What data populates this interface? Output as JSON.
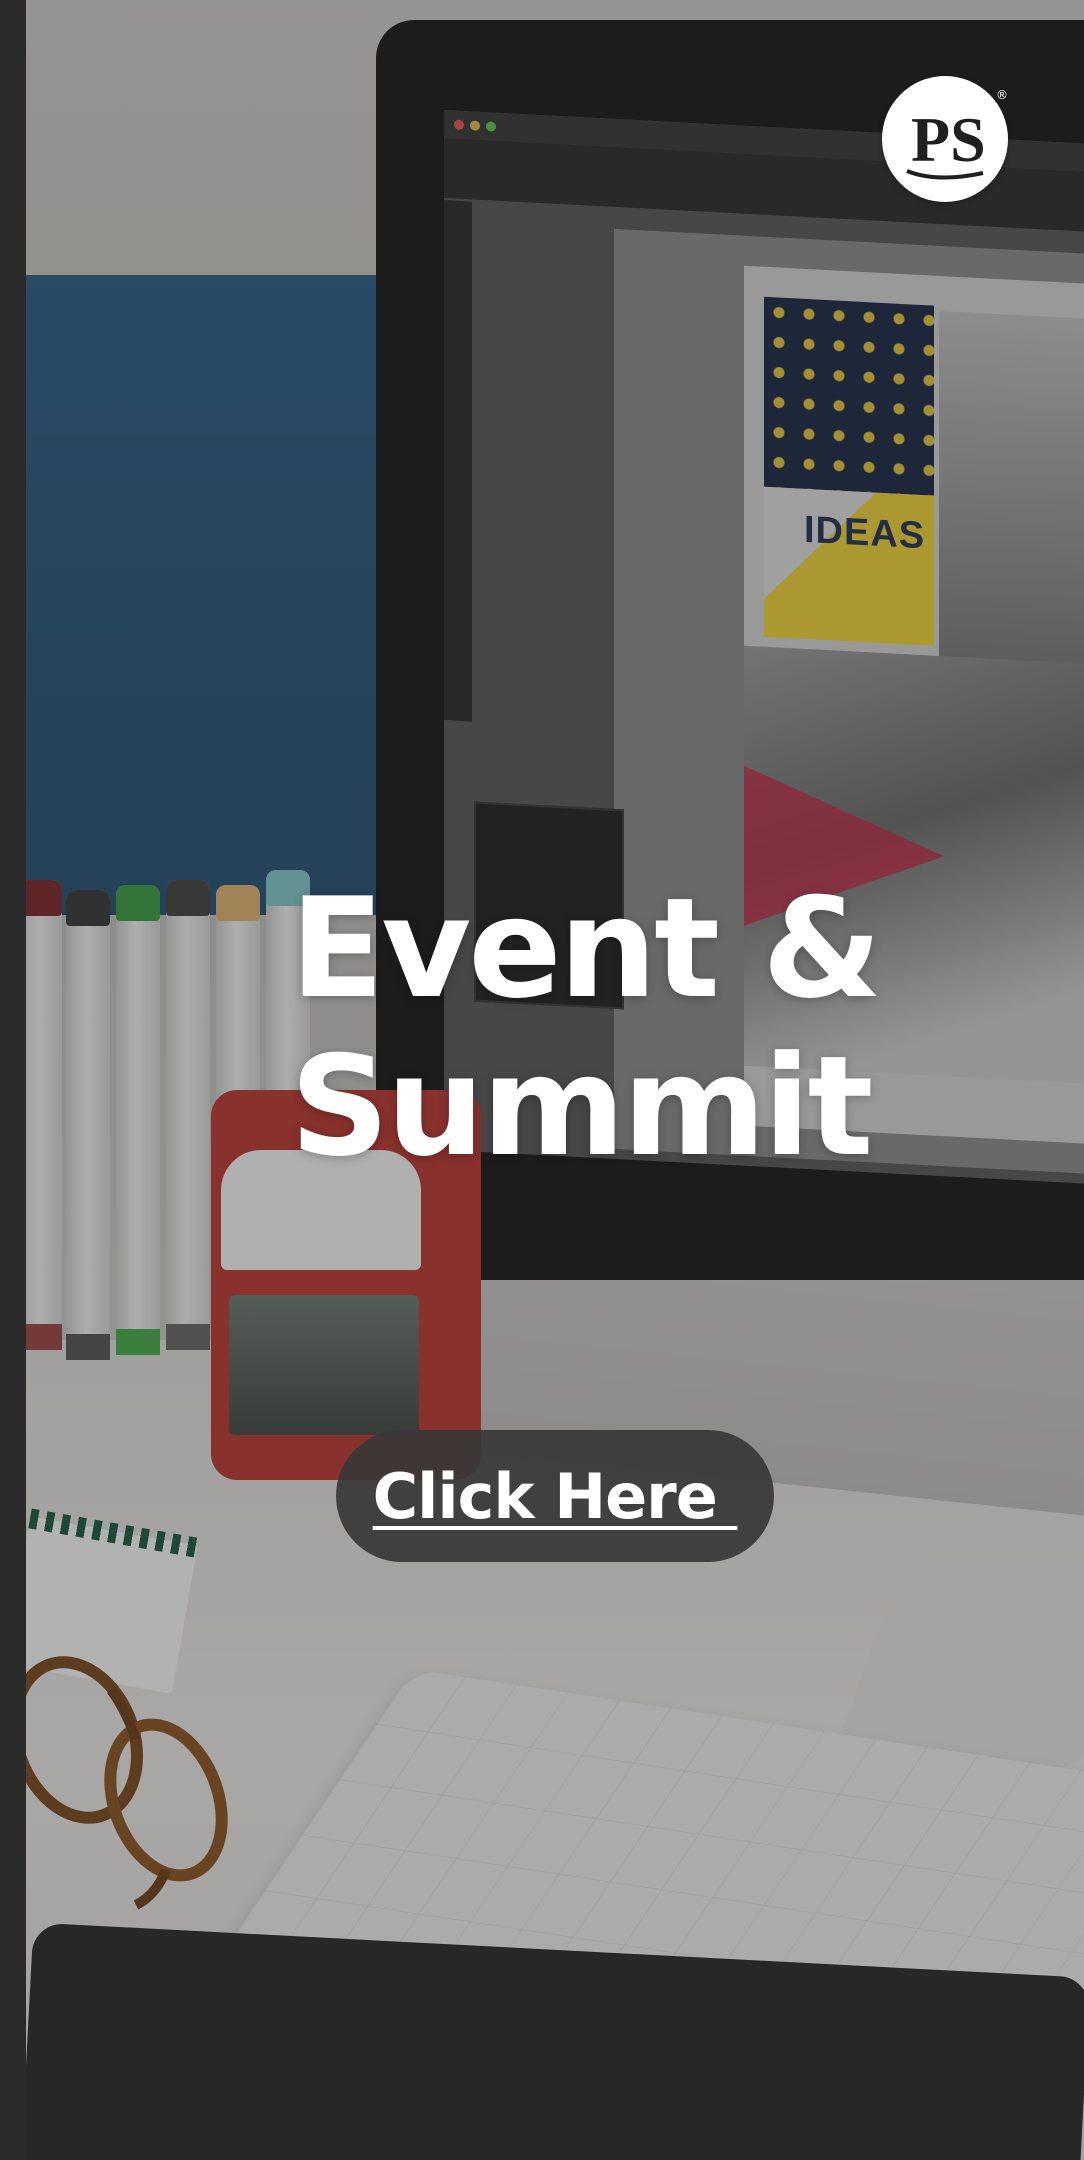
{
  "hero": {
    "title_line_1": "Event &",
    "title_line_2": "Summit"
  },
  "cta": {
    "label": "Click Here "
  },
  "logo": {
    "text": "PS",
    "registered_mark": "®"
  },
  "background": {
    "scene_description_icon": "desk-workspace-photo"
  },
  "colors": {
    "overlay": "#1e1e1e",
    "cta_background": "#373737",
    "text": "#ffffff",
    "logo_background": "#ffffff",
    "logo_text": "#222222"
  },
  "screen_mockup": {
    "poster_text": "IDEAS"
  }
}
